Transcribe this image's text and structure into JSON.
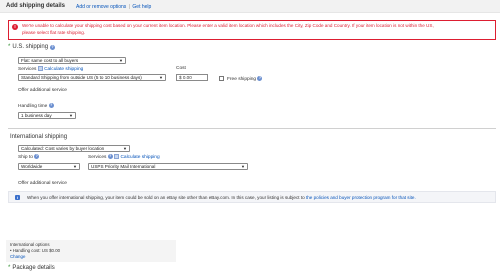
{
  "header": {
    "title": "Add shipping details",
    "link_add_remove": "Add or remove options",
    "separator": "|",
    "link_help": "Get help"
  },
  "error": {
    "icon": "!",
    "line1": "We're unable to calculate your shipping cost based on your current item location. Please enter a valid item location which includes the City, Zip Code and Country. If your item location is not within the US,",
    "line2": "please select flat rate shipping."
  },
  "us_shipping": {
    "required_marker": "*",
    "title": "U.S. shipping",
    "type_selected": "Flat: same cost to all buyers",
    "services_label": "Services",
    "calc_link": "Calculate shipping",
    "service_selected": "Standard Shipping from outside US (5 to 10 business days)",
    "cost_label": "Cost",
    "cost_value": "$ 0.00",
    "free_shipping_label": "Free shipping",
    "free_shipping_checked": false,
    "offer_additional": "Offer additional service",
    "handling_label": "Handling time",
    "handling_selected": "1 business day"
  },
  "international": {
    "title": "International shipping",
    "type_selected": "Calculated: Cost varies by buyer location",
    "ship_to_label": "Ship to",
    "ship_to_selected": "Worldwide",
    "services_label": "Services",
    "calc_link": "Calculate shipping",
    "service_selected": "USPS Priority Mail International",
    "offer_additional": "Offer additional service",
    "info_icon": "i",
    "info_text_prefix": "When you offer international shipping, your item could be sold on an eBay site other than eBay.com. In this case, your listing is subject to",
    "info_link": "the policies and buyer protection program for that site."
  },
  "summary": {
    "title": "International options",
    "handling_cost": "• Handling cost: US $0.00",
    "change_link": "Change"
  },
  "package": {
    "required_marker": "*",
    "title": "Package details"
  },
  "colors": {
    "error": "#dd1e31",
    "link": "#0654ba",
    "required": "#2a8c2a"
  }
}
